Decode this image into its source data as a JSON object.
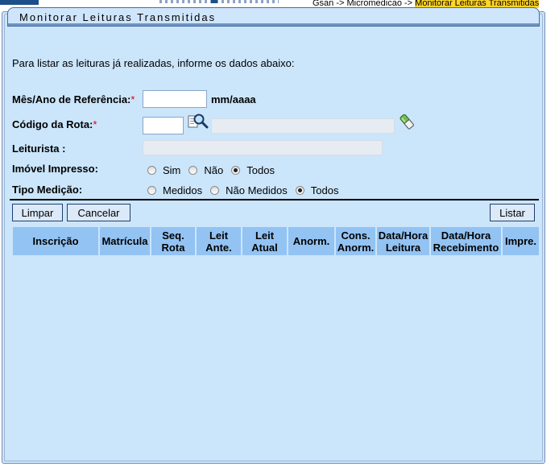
{
  "breadcrumb": {
    "part1": "Gsan -> Micromedicao -> ",
    "part2": "Monitorar Leituras Transmitidas"
  },
  "page": {
    "title": "Monitorar Leituras Transmitidas",
    "instructions": "Para listar as leituras já realizadas, informe os dados abaixo:"
  },
  "form": {
    "mes_ano": {
      "label": "Mês/Ano de Referência:",
      "required": "*",
      "value": "",
      "unit": "mm/aaaa"
    },
    "codigo_rota": {
      "label": "Código da Rota:",
      "required": "*",
      "value": "",
      "description": ""
    },
    "leiturista": {
      "label": "Leiturista :",
      "value": ""
    },
    "imovel_impresso": {
      "label": "Imóvel Impresso:",
      "options": [
        "Sim",
        "Não",
        "Todos"
      ],
      "selected": "Todos"
    },
    "tipo_medicao": {
      "label": "Tipo Medição:",
      "options": [
        "Medidos",
        "Não Medidos",
        "Todos"
      ],
      "selected": "Todos"
    }
  },
  "buttons": {
    "limpar": "Limpar",
    "cancelar": "Cancelar",
    "listar": "Listar"
  },
  "table": {
    "columns": [
      {
        "l1": "Inscrição",
        "l2": ""
      },
      {
        "l1": "Matrícula",
        "l2": ""
      },
      {
        "l1": "Seq.",
        "l2": "Rota"
      },
      {
        "l1": "Leit",
        "l2": "Ante."
      },
      {
        "l1": "Leit",
        "l2": "Atual"
      },
      {
        "l1": "Anorm.",
        "l2": ""
      },
      {
        "l1": "Cons.",
        "l2": "Anorm."
      },
      {
        "l1": "Data/Hora",
        "l2": "Leitura"
      },
      {
        "l1": "Data/Hora",
        "l2": "Recebimento"
      },
      {
        "l1": "Impre.",
        "l2": ""
      }
    ],
    "rows": []
  },
  "icons": {
    "search": "magnifier-icon",
    "clear": "eraser-icon"
  }
}
